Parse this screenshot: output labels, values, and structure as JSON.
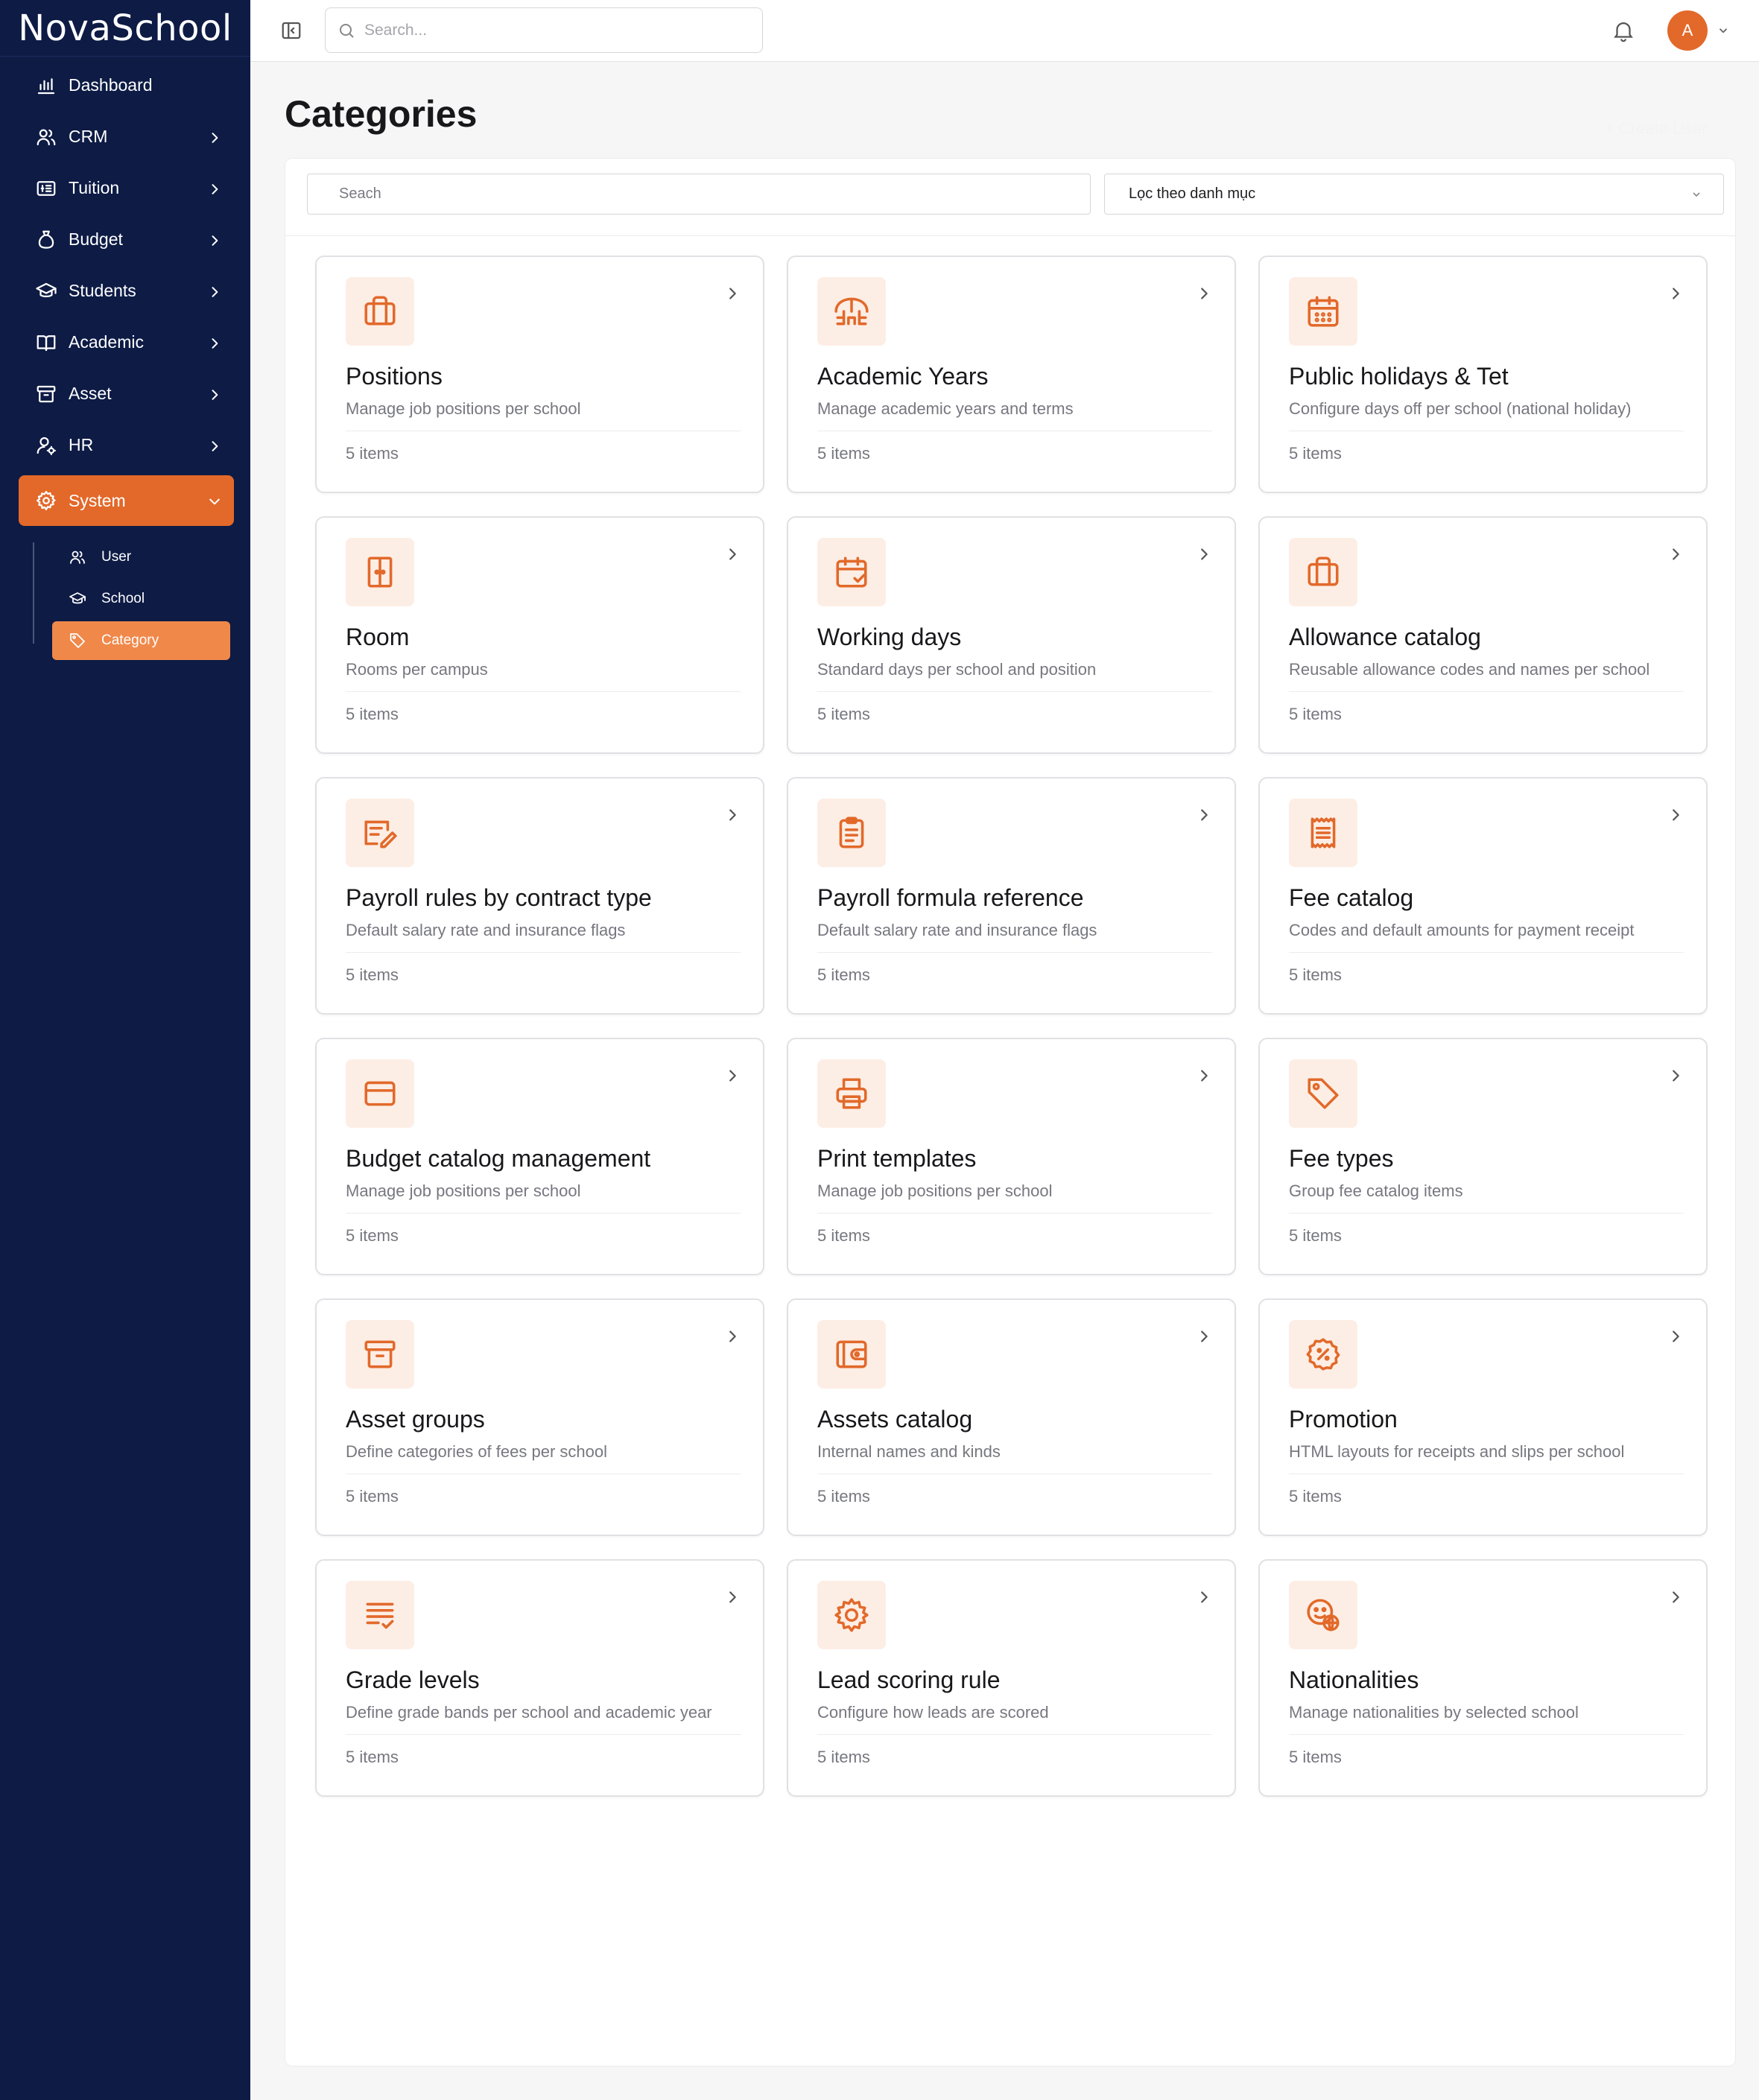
{
  "app": {
    "brand": "NovaSchool"
  },
  "sidebar": {
    "items": [
      {
        "label": "Dashboard",
        "icon": "bar-chart-icon",
        "has_children": false
      },
      {
        "label": "CRM",
        "icon": "users-icon",
        "has_children": true
      },
      {
        "label": "Tuition",
        "icon": "tuition-icon",
        "has_children": true
      },
      {
        "label": "Budget",
        "icon": "money-bag-icon",
        "has_children": true
      },
      {
        "label": "Students",
        "icon": "graduation-cap-icon",
        "has_children": true
      },
      {
        "label": "Academic",
        "icon": "book-icon",
        "has_children": true
      },
      {
        "label": "Asset",
        "icon": "archive-icon",
        "has_children": true
      },
      {
        "label": "HR",
        "icon": "user-gear-icon",
        "has_children": true
      }
    ],
    "active_item": {
      "label": "System",
      "icon": "gear-icon",
      "expanded": true
    },
    "subitems": [
      {
        "label": "User",
        "icon": "users-icon",
        "active": false
      },
      {
        "label": "School",
        "icon": "graduation-cap-icon",
        "active": false
      },
      {
        "label": "Category",
        "icon": "tag-icon",
        "active": true
      }
    ]
  },
  "topbar": {
    "search_placeholder": "Search...",
    "avatar_initial": "A"
  },
  "main": {
    "title": "Categories",
    "ghost_action": "+ Create User",
    "filter": {
      "search_placeholder": "Seach",
      "select_value": "Lọc theo danh mục"
    },
    "cards": [
      {
        "title": "Positions",
        "desc": "Manage job positions per school",
        "count": "5 items",
        "icon": "briefcase-icon"
      },
      {
        "title": "Academic Years",
        "desc": "Manage academic years and terms",
        "count": "5 items",
        "icon": "school-building-icon"
      },
      {
        "title": "Public holidays & Tet",
        "desc": "Configure days off per school (national holiday)",
        "count": "5 items",
        "icon": "calendar-icon"
      },
      {
        "title": "Room",
        "desc": "Rooms per campus",
        "count": "5 items",
        "icon": "door-icon"
      },
      {
        "title": "Working days",
        "desc": "Standard days per school and position",
        "count": "5 items",
        "icon": "calendar-check-icon"
      },
      {
        "title": "Allowance catalog",
        "desc": "Reusable allowance codes and names per school",
        "count": "5 items",
        "icon": "briefcase-icon"
      },
      {
        "title": "Payroll rules by contract type",
        "desc": "Default salary rate and insurance flags",
        "count": "5 items",
        "icon": "edit-list-icon"
      },
      {
        "title": "Payroll formula reference",
        "desc": "Default salary rate and insurance flags",
        "count": "5 items",
        "icon": "clipboard-icon"
      },
      {
        "title": "Fee catalog",
        "desc": "Codes and default amounts for payment receipt",
        "count": "5 items",
        "icon": "receipt-icon"
      },
      {
        "title": "Budget catalog management",
        "desc": "Manage job positions per school",
        "count": "5 items",
        "icon": "credit-card-icon"
      },
      {
        "title": "Print templates",
        "desc": "Manage job positions per school",
        "count": "5 items",
        "icon": "printer-icon"
      },
      {
        "title": "Fee types",
        "desc": "Group fee catalog items",
        "count": "5 items",
        "icon": "tag-icon"
      },
      {
        "title": "Asset groups",
        "desc": "Define categories of fees per school",
        "count": "5 items",
        "icon": "archive-icon"
      },
      {
        "title": "Assets catalog",
        "desc": "Internal names and kinds",
        "count": "5 items",
        "icon": "wallet-icon"
      },
      {
        "title": "Promotion",
        "desc": "HTML layouts for receipts and slips per school",
        "count": "5 items",
        "icon": "discount-badge-icon"
      },
      {
        "title": "Grade levels",
        "desc": "Define grade bands per school and academic year",
        "count": "5 items",
        "icon": "list-check-icon"
      },
      {
        "title": "Lead scoring rule",
        "desc": "Configure how leads are scored",
        "count": "5 items",
        "icon": "settings-gear-icon"
      },
      {
        "title": "Nationalities",
        "desc": "Manage nationalities by selected school",
        "count": "5 items",
        "icon": "globe-face-icon"
      }
    ]
  },
  "colors": {
    "sidebar_bg": "#0d1b45",
    "accent": "#e2692a",
    "accent_light": "#f0884a",
    "icon_tile_bg": "#fdeee5"
  }
}
